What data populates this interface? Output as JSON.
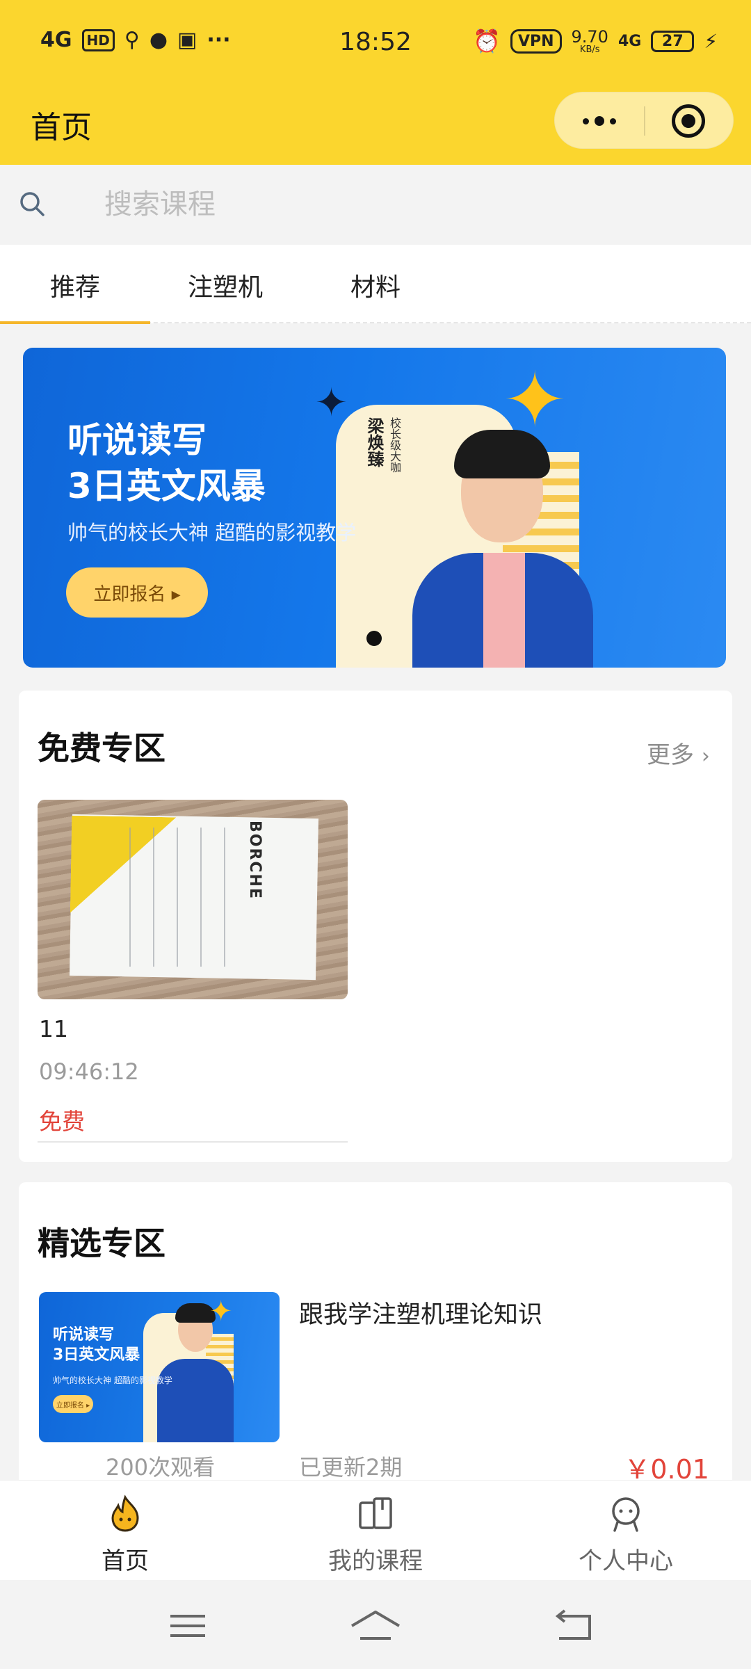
{
  "status_bar": {
    "network_left": "4G",
    "hd": "HD",
    "time": "18:52",
    "vpn": "VPN",
    "speed_value": "9.70",
    "speed_unit": "KB/s",
    "network_right": "4G",
    "battery": "27",
    "more_dots": "···"
  },
  "navbar": {
    "title": "首页",
    "capsule_more_icon": "more-dots-icon",
    "capsule_close_icon": "target-icon"
  },
  "search": {
    "placeholder": "搜索课程",
    "value": ""
  },
  "tabs": [
    {
      "label": "推荐",
      "active": true
    },
    {
      "label": "注塑机",
      "active": false
    },
    {
      "label": "材料",
      "active": false
    }
  ],
  "banner": {
    "headline_line1": "听说读写",
    "headline_line2": "3日英文风暴",
    "subline": "帅气的校长大神  超酷的影视教学",
    "button": "立即报名 ▸",
    "teacher_name": "梁焕臻",
    "teacher_title": "校长级大咖"
  },
  "free_section": {
    "title": "免费专区",
    "more": "更多",
    "item": {
      "thumb_brand": "BORCHE",
      "title": "11",
      "time": "09:46:12",
      "price_label": "免费"
    }
  },
  "featured_section": {
    "title": "精选专区",
    "item": {
      "thumb_line1": "听说读写",
      "thumb_line2": "3日英文风暴",
      "thumb_sub": "帅气的校长大神  超酷的影视教学",
      "thumb_button": "立即报名 ▸",
      "title": "跟我学注塑机理论知识",
      "views": "200次观看",
      "updated": "已更新2期",
      "price": "￥0.01"
    }
  },
  "bottom_tabs": [
    {
      "label": "首页",
      "icon": "flame-home-icon",
      "active": true
    },
    {
      "label": "我的课程",
      "icon": "book-icon",
      "active": false
    },
    {
      "label": "个人中心",
      "icon": "user-icon",
      "active": false
    }
  ],
  "colors": {
    "brand_yellow": "#fbd62e",
    "accent_underline": "#f5b62a",
    "price_red": "#e2443a",
    "banner_blue": "#1477ea"
  }
}
